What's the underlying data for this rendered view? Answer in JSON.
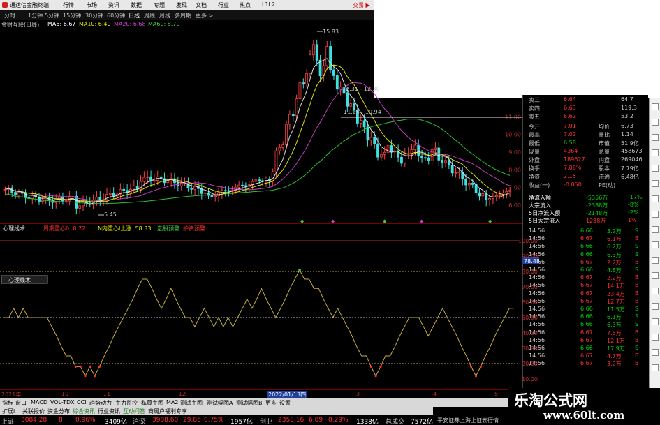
{
  "titlebar": {
    "app_title": "通达信金融终端",
    "menu": [
      "行情",
      "市场",
      "资讯",
      "数据",
      "专题",
      "发现",
      "文档",
      "行业",
      "热点",
      "L1L2"
    ],
    "trade": "交易 ▶"
  },
  "periodbar": {
    "items": [
      "分时",
      "1分钟",
      "5分钟",
      "15分钟",
      "30分钟",
      "60分钟",
      "日线",
      "周线",
      "月线",
      "多周期",
      "更多 >"
    ],
    "active": "日线"
  },
  "ma_header": {
    "name": "金财互联(日线)",
    "ma5": "MA5: 6.67",
    "ma10": "MA10: 6.40",
    "ma20": "MA20: 6.68",
    "ma60": "MA60: 8.70"
  },
  "main_chart": {
    "annotations": {
      "high": "15.83",
      "low": "5.45",
      "level1": "12.31 - 12.30",
      "level2": "11.05 - 10.94"
    },
    "y_ticks": [
      "11.00",
      "10.00",
      "9.00",
      "8.00",
      "7.00",
      "6.00"
    ],
    "markers": [
      "◆",
      "◆",
      "◆",
      "◆",
      "◆"
    ]
  },
  "quote_panel": {
    "rows": [
      {
        "label": "卖三",
        "price": "6.64",
        "vol": "64.7"
      },
      {
        "label": "卖四",
        "price": "6.63",
        "vol": "119.3"
      },
      {
        "label": "卖五",
        "price": "6.62",
        "vol": "53.2"
      },
      {
        "label": "今开",
        "price": "7.01",
        "label2": "均价",
        "vol": "6.73"
      },
      {
        "label": "最高",
        "price": "7.02",
        "label2": "量比",
        "vol": "1.14"
      },
      {
        "label": "最低",
        "price": "6.58",
        "label2": "市值",
        "vol": "51.9亿"
      },
      {
        "label": "现量",
        "price": "4364",
        "label2": "总量",
        "vol": "458673"
      },
      {
        "label": "外盘",
        "price": "189627",
        "label2": "内盘",
        "vol": "269046"
      },
      {
        "label": "换手",
        "price": "7.08%",
        "label2": "股本",
        "vol": "7.79亿"
      },
      {
        "label": "净资",
        "price": "2.15",
        "label2": "流通",
        "vol": "6.48亿"
      },
      {
        "label": "收益(一)",
        "price": "-0.050",
        "label2": "PE(动)",
        "vol": ""
      }
    ],
    "flows": [
      {
        "label": "净流入额",
        "value": "-5356万",
        "pct": "-17%"
      },
      {
        "label": "大宗流入",
        "value": "-2388万",
        "pct": "-8%"
      },
      {
        "label": "5日净流入额",
        "value": "-2148万",
        "pct": "-2%"
      },
      {
        "label": "5日大宗流入",
        "value": "1238万",
        "pct": "1%"
      }
    ],
    "ticks": [
      {
        "time": "14:56",
        "price": "6.66",
        "vol": "3.2万",
        "side": "S"
      },
      {
        "time": "14:56",
        "price": "6.67",
        "vol": "6.1万",
        "side": "B"
      },
      {
        "time": "14:56",
        "price": "6.66",
        "vol": "6.2万",
        "side": "S"
      },
      {
        "time": "14:56",
        "price": "6.66",
        "vol": "6.3万",
        "side": "S"
      },
      {
        "time": "14:56",
        "price": "6.67",
        "vol": "2.2万",
        "side": "B"
      },
      {
        "time": "14:56",
        "price": "6.66",
        "vol": "4.8万",
        "side": "S"
      },
      {
        "time": "14:56",
        "price": "6.67",
        "vol": "2.2万",
        "side": "B"
      },
      {
        "time": "14:56",
        "price": "6.67",
        "vol": "14.1万",
        "side": "B"
      },
      {
        "time": "14:56",
        "price": "6.67",
        "vol": "23.4万",
        "side": "B"
      },
      {
        "time": "14:56",
        "price": "6.67",
        "vol": "12.7万",
        "side": "B"
      },
      {
        "time": "14:56",
        "price": "6.66",
        "vol": "11.5万",
        "side": "S"
      },
      {
        "time": "14:56",
        "price": "6.66",
        "vol": "6.1万",
        "side": "S"
      },
      {
        "time": "14:56",
        "price": "6.66",
        "vol": "6.3万",
        "side": "S"
      },
      {
        "time": "14:56",
        "price": "6.67",
        "vol": "7.5万",
        "side": "B"
      },
      {
        "time": "14:56",
        "price": "6.67",
        "vol": "12.1万",
        "side": "B"
      },
      {
        "time": "14:56",
        "price": "6.66",
        "vol": "17.9万",
        "side": "S"
      },
      {
        "time": "14:56",
        "price": "6.67",
        "vol": "4.7万",
        "side": "B"
      },
      {
        "time": "14:56",
        "price": "6.67",
        "vol": "3.2万",
        "side": "B"
      }
    ]
  },
  "indicator": {
    "name": "心理线术",
    "label_a": "周期重心0: 8.72",
    "label_b": "N内重心Ⅰ上涨: 58.33",
    "label_c": "选股预警",
    "label_d": "护资预警",
    "current_value": "78.48",
    "y_ticks": [
      "100.00",
      "90.00",
      "80.00",
      "70.00",
      "60.00",
      "50.00",
      "40.00",
      "30.00",
      "20.00",
      "10.00"
    ],
    "legend_box": "心理线术",
    "series": [
      50,
      50,
      56,
      50,
      56,
      50,
      50,
      50,
      50,
      50,
      44,
      38,
      31,
      25,
      25,
      18,
      18,
      12,
      18,
      12,
      18,
      25,
      31,
      38,
      44,
      50,
      56,
      62,
      69,
      75,
      75,
      69,
      62,
      56,
      62,
      69,
      62,
      56,
      50,
      50,
      44,
      50,
      56,
      50,
      44,
      50,
      44,
      50,
      44,
      50,
      56,
      62,
      56,
      62,
      69,
      62,
      56,
      50,
      56,
      62,
      69,
      75,
      81,
      75,
      75,
      69,
      69,
      62,
      56,
      50,
      56,
      50,
      44,
      38,
      31,
      25,
      25,
      18,
      12,
      18,
      25,
      25,
      31,
      38,
      44,
      50,
      50,
      50,
      44,
      38,
      44,
      50,
      56,
      50,
      44,
      38,
      31,
      25,
      18,
      12,
      18,
      25,
      31,
      38,
      44,
      50,
      56,
      56
    ]
  },
  "datestrip": {
    "labels": [
      "2021年",
      "10",
      "11",
      "12",
      "2022/01/13四",
      "3",
      "4",
      "5"
    ]
  },
  "tabs": {
    "row1": [
      "指标",
      "窗口",
      "MACD",
      "VOL-TDX",
      "CCI",
      "趋势动力",
      "主力监控",
      "私募主图",
      "MA2",
      "测试主图",
      "测试幅图A",
      "测试幅图B",
      "更多",
      "设置"
    ],
    "row1_right": "模板",
    "row2": [
      "扩展ⅰ",
      "关联报价",
      "资金分布",
      "综合资讯",
      "行业资讯",
      "互动问答",
      "商周户福利专享"
    ]
  },
  "indexbar": {
    "sh_label": "上证",
    "sh_value": "3084.28",
    "sh_change": "8",
    "sh_pct": "0.96%",
    "sh_amount": "3409亿",
    "sz_label": "沪深",
    "sz_value": "3988.60",
    "sz_change": "29.86",
    "sz_pct": "0.75%",
    "sz_amount": "1957亿",
    "cy_label": "创业",
    "cy_value": "2358.16",
    "cy_change": "6.89",
    "cy_pct": "0.29%",
    "cy_amount": "1338亿",
    "total_label": "总成交",
    "total_value": "7572亿",
    "broker": "平安证券上海上证云行情"
  },
  "watermark": {
    "cn": "乐淘公式网",
    "url": "www.60lt.com"
  }
}
